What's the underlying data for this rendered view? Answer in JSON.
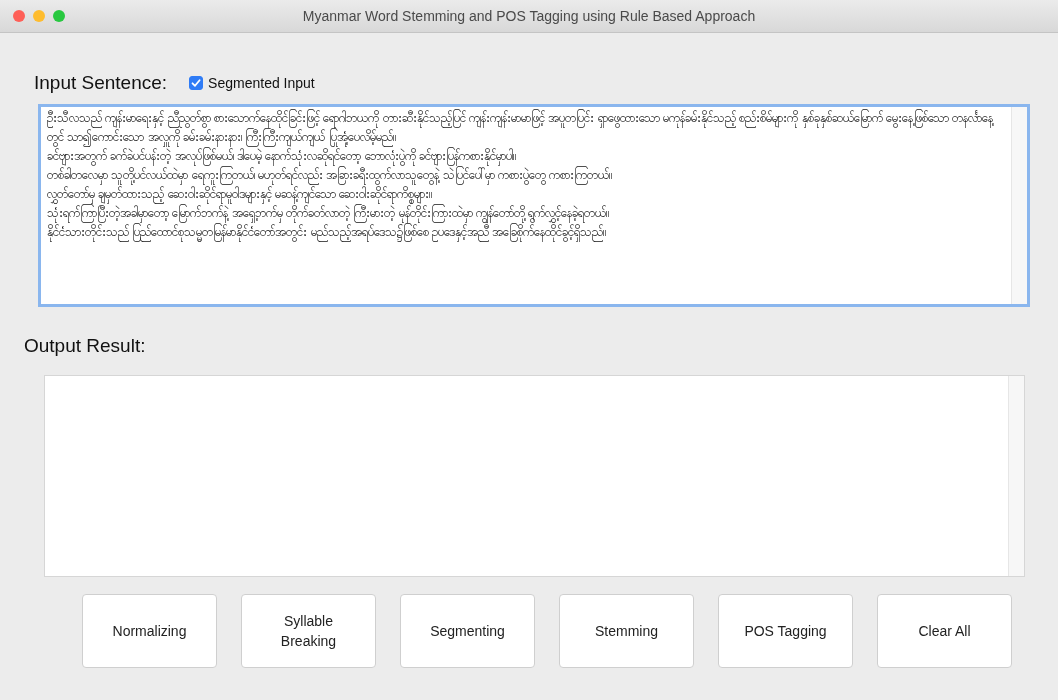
{
  "window": {
    "title": "Myanmar Word Stemming and POS Tagging using Rule Based Approach"
  },
  "input": {
    "label": "Input Sentence:",
    "segmented": {
      "label": "Segmented Input",
      "checked": true
    },
    "lines": [
      "ဦးသီလသည် ကျန်းမာရေးနှင့် ညီညွတ်စွာ စားသောက်နေထိုင်ခြင်းဖြင့် ရောဂါဘယကို တားဆီးနိုင်သည့်ပြင် ကျန်းကျန်းမာမာဖြင့် အပူတပြင်း ရှာဖွေထားသော မကုန်ခမ်းနိုင်သည့် စည်းစိမ်များကို နှစ်ခုနှစ်ဆယ်မြောက် မွေးနေ့ဖြစ်သော တနင်္လာနေ့တွင် သာ၍ကောင်းသော အလှူကို ခမ်းခမ်းနားနား၊ ကြီးကြီးကျယ်ကျယ် ပြုအုံ့ပေလိမ့်မည်။",
      "ခင်ဗျားအတွက် ခက်ခဲပင်ပန်းတဲ့ အလုပ်ဖြစ်မယ်၊ ဒါပေမဲ့ နောက်သုံးလဆိုရင်တော့ ဘောလုံးပွဲကို ခင်ဗျားပြန်ကစားနိုင်မှာပါ။",
      "တစ်ခါတလေမှာ သူတို့ပင်လယ်ထဲမှာ ရေကူးကြတယ်၊ မဟုတ်ရင်လည်း အခြားခရီးထွက်လာသူတွေနဲ့ သဲပြင်ပေါ်မှာ ကစားပွဲတွေ ကစားကြတယ်။",
      "လွှတ်တော်မှ ချမှတ်ထားသည့် ဆေးဝါးဆိုင်ရာမူဝါဒများနှင့် မဆန့်ကျင်သော ဆေးဝါးဆိုင်ရာကိစ္စများ။",
      "သုံးရက်ကြာပြီးတဲ့အခါမှာတော့ မြောက်ဘက်နဲ့ အရှေ့ဘက်မှ တိုက်ခတ်လာတဲ့ ကြီးမားတဲ့ မုန်တိုင်းကြားထဲမှာ ကျွန်တော်တို့ ရွက်လွှင့်နေခဲ့ရတယ်။",
      "နိုင်ငံသားတိုင်းသည် ပြည်ထောင်စုသမ္မတမြန်မာနိုင်ငံတော်အတွင်း မည်သည့်အရပ်ဒေသ၌ဖြစ်စေ ဥပဒေနှင့်အညီ အခြေစိုက်နေထိုင်ခွင့်ရှိသည်။"
    ]
  },
  "output": {
    "label": "Output Result:"
  },
  "buttons": [
    "Normalizing",
    "Syllable\nBreaking",
    "Segmenting",
    "Stemming",
    "POS Tagging",
    "Clear All"
  ]
}
